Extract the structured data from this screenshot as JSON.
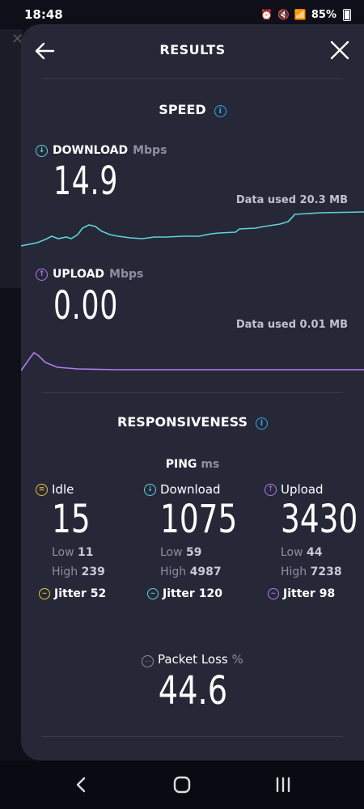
{
  "status_bar": {
    "time": "18:48",
    "battery": "85%"
  },
  "header": {
    "title": "RESULTS"
  },
  "speed": {
    "title": "SPEED",
    "download": {
      "label": "DOWNLOAD",
      "unit": "Mbps",
      "value": "14.9",
      "data_used": "Data used 20.3 MB"
    },
    "upload": {
      "label": "UPLOAD",
      "unit": "Mbps",
      "value": "0.00",
      "data_used": "Data used 0.01 MB"
    }
  },
  "responsiveness": {
    "title": "RESPONSIVENESS",
    "ping_label": "PING",
    "ping_unit": "ms",
    "columns": [
      {
        "label": "Idle",
        "value": "15",
        "low_label": "Low",
        "low": "11",
        "high_label": "High",
        "high": "239",
        "jitter_label": "Jitter",
        "jitter": "52"
      },
      {
        "label": "Download",
        "value": "1075",
        "low_label": "Low",
        "low": "59",
        "high_label": "High",
        "high": "4987",
        "jitter_label": "Jitter",
        "jitter": "120"
      },
      {
        "label": "Upload",
        "value": "3430",
        "low_label": "Low",
        "low": "44",
        "high_label": "High",
        "high": "7238",
        "jitter_label": "Jitter",
        "jitter": "98"
      }
    ],
    "packet_loss": {
      "label": "Packet Loss",
      "unit": "%",
      "value": "44.6"
    }
  },
  "colors": {
    "download": "#5fd3d8",
    "upload": "#b27cf0",
    "idle": "#e8c53a",
    "info": "#2fa7e8"
  }
}
